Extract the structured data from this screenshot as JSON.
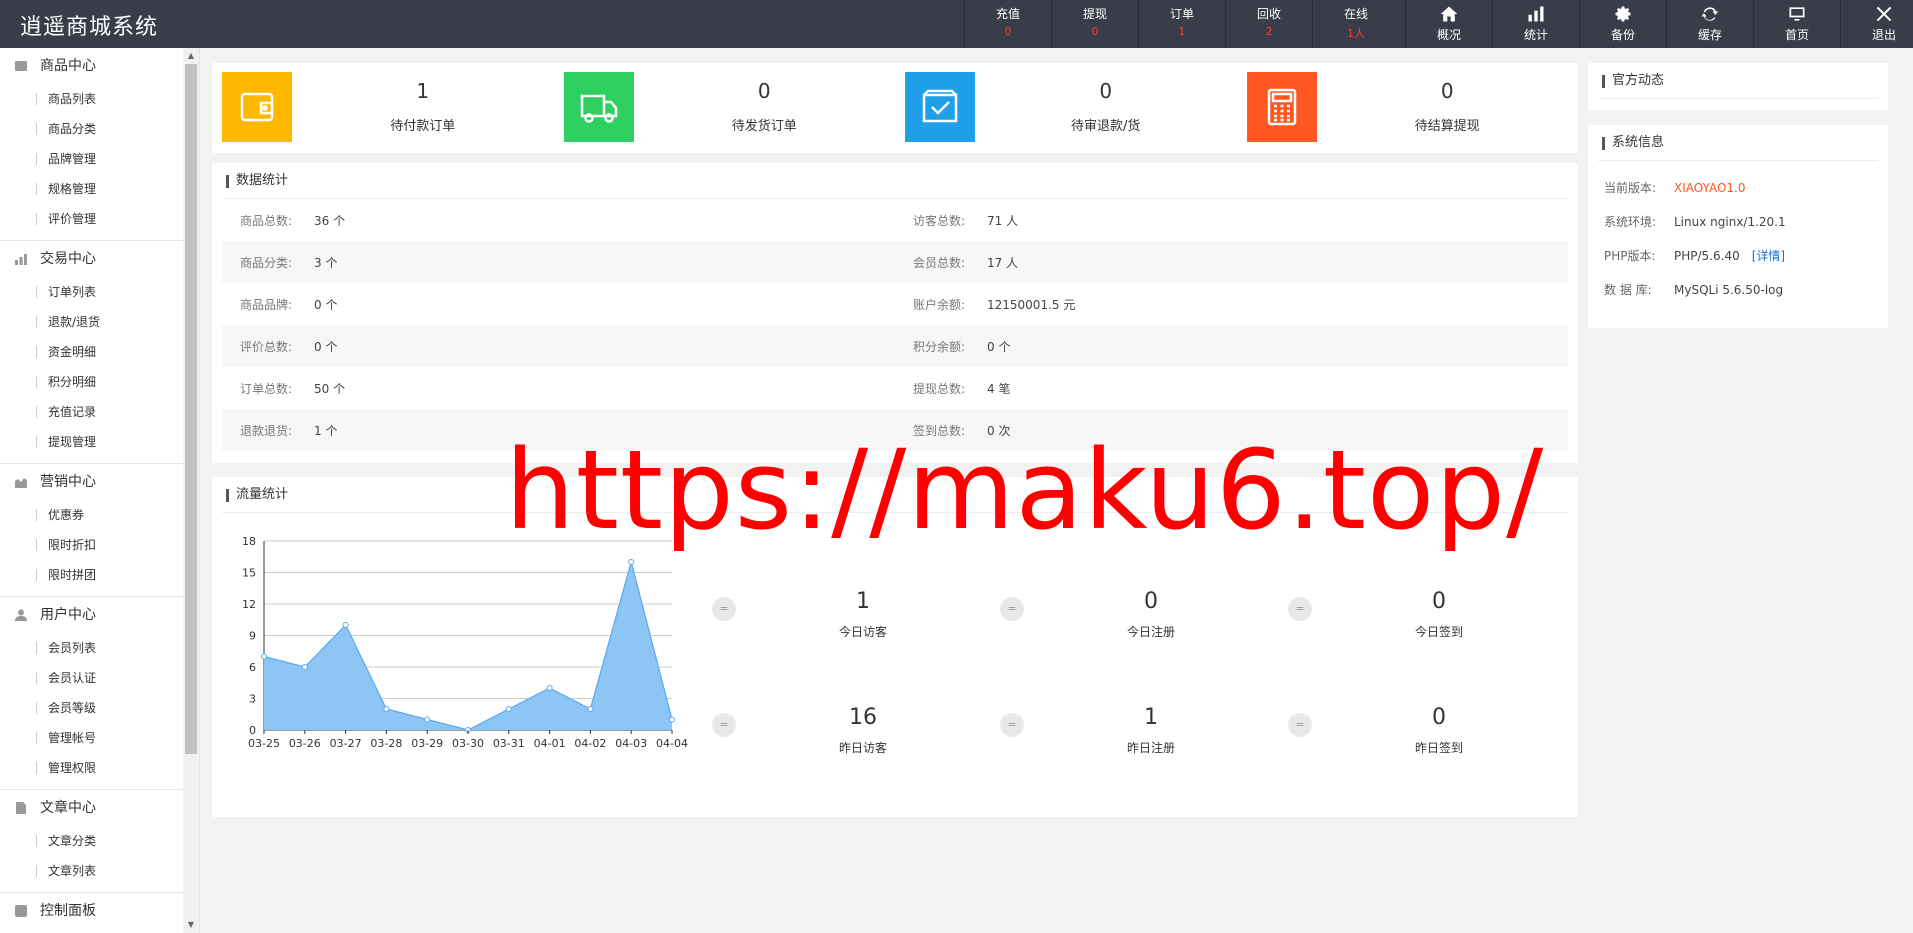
{
  "app": {
    "title": "逍遥商城系统"
  },
  "topbar": {
    "stats": [
      {
        "label": "充值",
        "value": "0"
      },
      {
        "label": "提现",
        "value": "0"
      },
      {
        "label": "订单",
        "value": "1"
      },
      {
        "label": "回收",
        "value": "2"
      },
      {
        "label": "在线",
        "value": "1人"
      }
    ],
    "actions": [
      {
        "label": "概况",
        "icon": "home-icon"
      },
      {
        "label": "统计",
        "icon": "bar-chart-icon"
      },
      {
        "label": "备份",
        "icon": "gear-icon"
      },
      {
        "label": "缓存",
        "icon": "refresh-icon"
      },
      {
        "label": "首页",
        "icon": "monitor-icon"
      },
      {
        "label": "退出",
        "icon": "close-icon"
      }
    ]
  },
  "sidebar": {
    "groups": [
      {
        "title": "商品中心",
        "icon": "goods-icon",
        "items": [
          "商品列表",
          "商品分类",
          "品牌管理",
          "规格管理",
          "评价管理"
        ]
      },
      {
        "title": "交易中心",
        "icon": "bar-chart-icon",
        "items": [
          "订单列表",
          "退款/退货",
          "资金明细",
          "积分明细",
          "充值记录",
          "提现管理"
        ]
      },
      {
        "title": "营销中心",
        "icon": "marketing-chart-icon",
        "items": [
          "优惠券",
          "限时折扣",
          "限时拼团"
        ]
      },
      {
        "title": "用户中心",
        "icon": "user-icon",
        "items": [
          "会员列表",
          "会员认证",
          "会员等级",
          "管理帐号",
          "管理权限"
        ]
      },
      {
        "title": "文章中心",
        "icon": "document-icon",
        "items": [
          "文章分类",
          "文章列表"
        ]
      },
      {
        "title": "控制面板",
        "icon": "settings-icon",
        "items": []
      }
    ]
  },
  "cards": [
    {
      "value": "1",
      "label": "待付款订单",
      "color": "#ffb800",
      "icon": "wallet-icon"
    },
    {
      "value": "0",
      "label": "待发货订单",
      "color": "#2ed15f",
      "icon": "truck-icon"
    },
    {
      "value": "0",
      "label": "待审退款/货",
      "color": "#1e9fe8",
      "icon": "checkbox-icon"
    },
    {
      "value": "0",
      "label": "待结算提现",
      "color": "#ff5722",
      "icon": "calculator-icon"
    }
  ],
  "data_stats": {
    "title": "数据统计",
    "rows": [
      [
        {
          "k": "商品总数:",
          "v": "36 个"
        },
        {
          "k": "访客总数:",
          "v": "71 人"
        }
      ],
      [
        {
          "k": "商品分类:",
          "v": "3 个"
        },
        {
          "k": "会员总数:",
          "v": "17 人"
        }
      ],
      [
        {
          "k": "商品品牌:",
          "v": "0 个"
        },
        {
          "k": "账户余额:",
          "v": "12150001.5 元"
        }
      ],
      [
        {
          "k": "评价总数:",
          "v": "0 个"
        },
        {
          "k": "积分余额:",
          "v": "0 个"
        }
      ],
      [
        {
          "k": "订单总数:",
          "v": "50 个"
        },
        {
          "k": "提现总数:",
          "v": "4 笔"
        }
      ],
      [
        {
          "k": "退款退货:",
          "v": "1 个"
        },
        {
          "k": "签到总数:",
          "v": "0 次"
        }
      ]
    ]
  },
  "flow": {
    "title": "流量统计",
    "metrics": [
      {
        "value": "1",
        "label": "今日访客"
      },
      {
        "value": "0",
        "label": "今日注册"
      },
      {
        "value": "0",
        "label": "今日签到"
      },
      {
        "value": "16",
        "label": "昨日访客"
      },
      {
        "value": "1",
        "label": "昨日注册"
      },
      {
        "value": "0",
        "label": "昨日签到"
      }
    ],
    "eq_symbol": "="
  },
  "chart_data": {
    "type": "area",
    "categories": [
      "03-25",
      "03-26",
      "03-27",
      "03-28",
      "03-29",
      "03-30",
      "03-31",
      "04-01",
      "04-02",
      "04-03",
      "04-04"
    ],
    "values": [
      7,
      6,
      10,
      2,
      1,
      0,
      2,
      4,
      2,
      16,
      1
    ],
    "ylim": [
      0,
      18
    ],
    "yticks": [
      0,
      3,
      6,
      9,
      12,
      15,
      18
    ],
    "title": "",
    "xlabel": "",
    "ylabel": "",
    "grid": true,
    "fill_color": "#8dc5f5",
    "line_color": "#5aa9ef"
  },
  "official": {
    "title": "官方动态"
  },
  "sysinfo": {
    "title": "系统信息",
    "rows": [
      {
        "k": "当前版本:",
        "v": "XIAOYAO1.0"
      },
      {
        "k": "系统环境:",
        "v": "Linux nginx/1.20.1"
      },
      {
        "k": "PHP版本:",
        "v": "PHP/5.6.40",
        "link": "[详情]"
      },
      {
        "k": "数 据 库:",
        "v": "MySQLi 5.6.50-log"
      }
    ]
  },
  "watermark": "https://maku6.top/"
}
